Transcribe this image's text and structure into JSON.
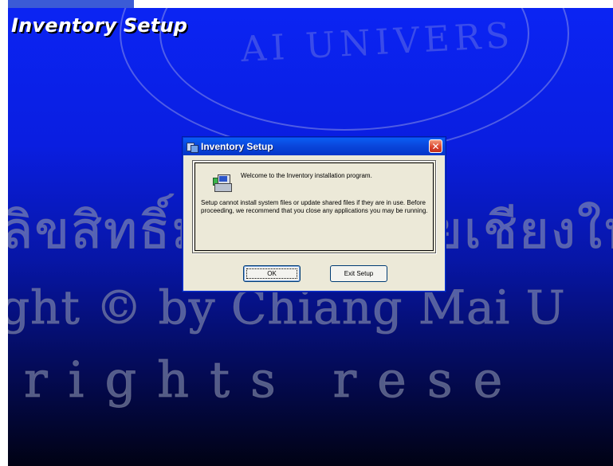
{
  "background": {
    "title": "Inventory Setup",
    "colors": {
      "gradient_top": "#0b24f3",
      "gradient_bottom": "#010214"
    }
  },
  "watermark": {
    "seal_text": "AI UNIVERS",
    "line1": "ลิขสิทธิ์มหาวิทยาลัยเชียงใหม่",
    "line2": "ght © by Chiang Mai U",
    "line3": "rights rese"
  },
  "dialog": {
    "title": "Inventory Setup",
    "title_icon": "setup-window-icon",
    "close_icon": "close-icon",
    "welcome": "Welcome to the Inventory installation program.",
    "message": "Setup cannot install system files or update shared files if they are in use. Before proceeding, we recommend that you close any applications you may be running.",
    "buttons": {
      "ok": "OK",
      "exit": "Exit Setup"
    }
  },
  "colors": {
    "dialog_face": "#ece9d8",
    "titlebar": "#0a5ef4",
    "close": "#d9412b"
  }
}
